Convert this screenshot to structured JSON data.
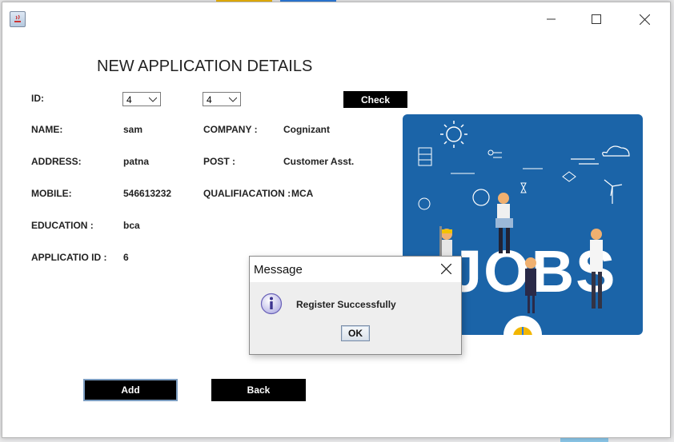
{
  "window": {
    "title": ""
  },
  "form": {
    "heading": "NEW APPLICATION DETAILS",
    "id_label": "ID:",
    "id_combo_1": "4",
    "id_combo_2": "4",
    "check_label": "Check",
    "fields": {
      "name_label": "NAME:",
      "name_value": "sam",
      "company_label": "COMPANY :",
      "company_value": "Cognizant",
      "address_label": "ADDRESS:",
      "address_value": "patna",
      "post_label": "POST :",
      "post_value": "Customer Asst.",
      "mobile_label": "MOBILE:",
      "mobile_value": "546613232",
      "qualification_label": "QUALIFIACATION :",
      "qualification_value": "MCA",
      "education_label": "EDUCATION :",
      "education_value": "bca",
      "application_id_label": "APPLICATIO ID :",
      "application_id_value": "6"
    },
    "add_label": "Add",
    "back_label": "Back"
  },
  "image": {
    "text": "JOBS",
    "icon": "jobs-illustration"
  },
  "dialog": {
    "title": "Message",
    "message": "Register Successfully",
    "ok_label": "OK",
    "icon": "info-icon"
  },
  "colors": {
    "image_bg": "#1b64a8",
    "button_bg": "#000000",
    "dialog_bg": "#eeeeee"
  }
}
